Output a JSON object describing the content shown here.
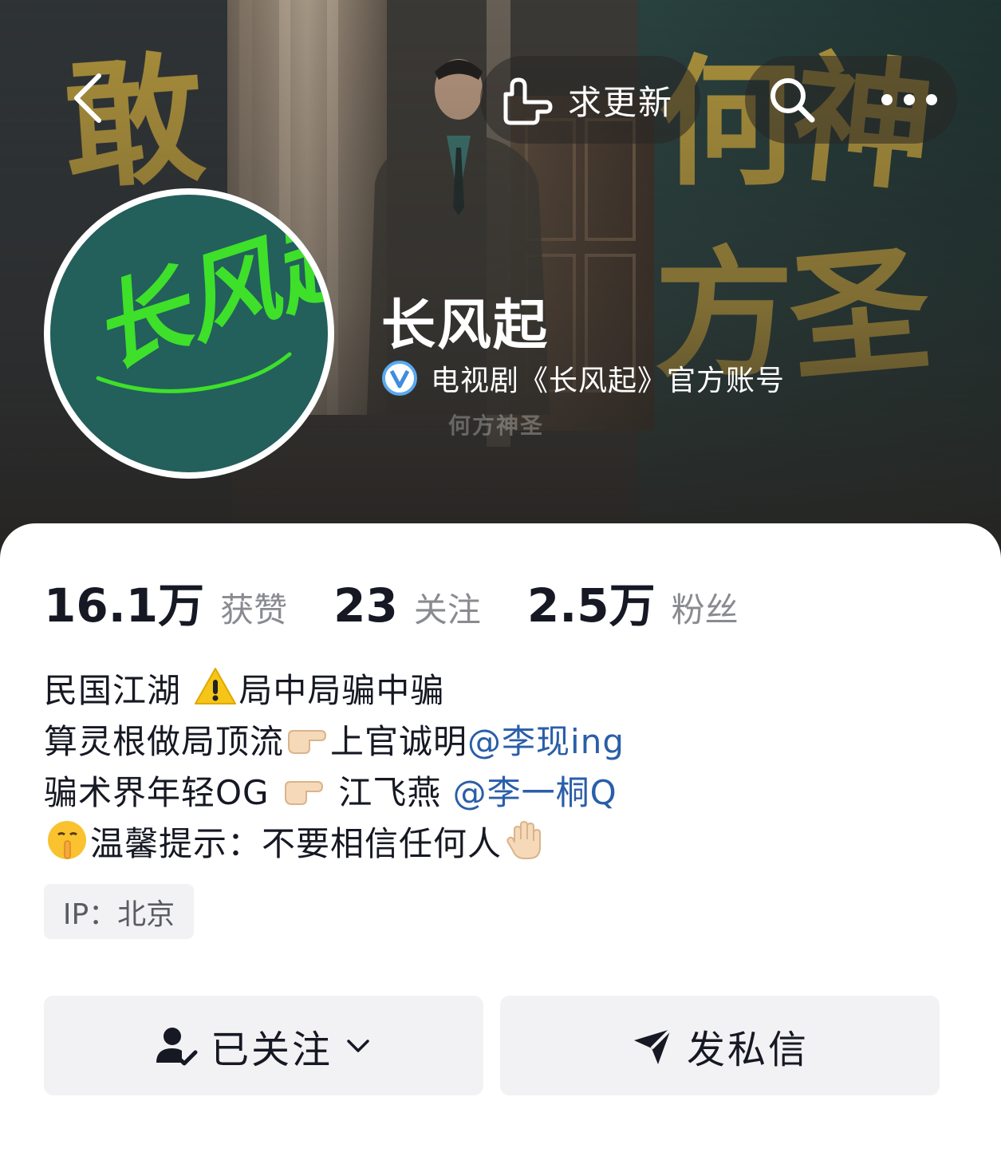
{
  "header": {
    "request_update_label": "求更新",
    "back_icon": "chevron-left-icon",
    "search_icon": "search-icon",
    "more_icon": "more-dots-icon",
    "banner_subtitle": "何方神圣",
    "banner_calligraphy": [
      "敢",
      "何",
      "神",
      "方",
      "圣"
    ]
  },
  "profile": {
    "name": "长风起",
    "verified_text": "电视剧《长风起》官方账号",
    "avatar_text": "长风起",
    "stats": [
      {
        "value": "16.1万",
        "label": "获赞"
      },
      {
        "value": "23",
        "label": "关注"
      },
      {
        "value": "2.5万",
        "label": "粉丝"
      }
    ],
    "bio": {
      "line1_a": "民国江湖 ",
      "line1_b": "局中局骗中骗",
      "line2_a": "算灵根做局顶流",
      "line2_b": "上官诚明",
      "line2_mention": "@李现ing",
      "line3_a": "骗术界年轻OG ",
      "line3_b": " 江飞燕 ",
      "line3_mention": "@李一桐Q",
      "line4_a": "温馨提示：不要相信任何人"
    },
    "ip": "IP：北京"
  },
  "actions": {
    "follow_label": "已关注",
    "message_label": "发私信"
  },
  "colors": {
    "accent_link": "#2a5ea8",
    "avatar_bg": "#235f5b",
    "calligraphy_green": "#3ee02a",
    "gold": "#b99a3d"
  }
}
